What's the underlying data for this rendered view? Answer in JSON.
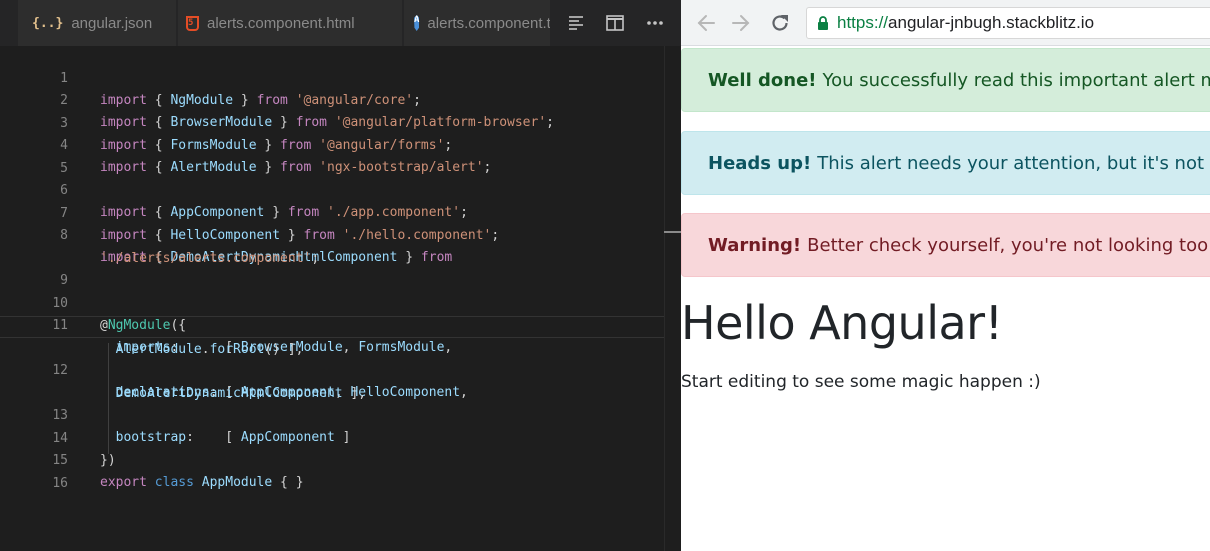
{
  "editor": {
    "tabs": [
      {
        "label": "angular.json",
        "icon": "json-file-icon",
        "icon_glyph": "{..}"
      },
      {
        "label": "alerts.component.html",
        "icon": "html5-file-icon",
        "icon_glyph": "5"
      },
      {
        "label": "alerts.component.ts",
        "icon": "angular-file-icon",
        "icon_glyph": "A"
      }
    ],
    "actions": [
      "outline-icon",
      "split-editor-icon",
      "more-icon"
    ],
    "line_numbers": [
      "1",
      "2",
      "3",
      "4",
      "5",
      "6",
      "7",
      "8",
      "",
      "9",
      "10",
      "11",
      "",
      "12",
      "",
      "13",
      "14",
      "15",
      "16"
    ],
    "code": {
      "l1": [
        "import",
        " { ",
        "NgModule",
        " } ",
        "from",
        " ",
        "'@angular/core'",
        ";"
      ],
      "l2": [
        "import",
        " { ",
        "BrowserModule",
        " } ",
        "from",
        " ",
        "'@angular/platform-browser'",
        ";"
      ],
      "l3": [
        "import",
        " { ",
        "FormsModule",
        " } ",
        "from",
        " ",
        "'@angular/forms'",
        ";"
      ],
      "l4": [
        "import",
        " { ",
        "AlertModule",
        " } ",
        "from",
        " ",
        "'ngx-bootstrap/alert'",
        ";"
      ],
      "l6": [
        "import",
        " { ",
        "AppComponent",
        " } ",
        "from",
        " ",
        "'./app.component'",
        ";"
      ],
      "l7": [
        "import",
        " { ",
        "HelloComponent",
        " } ",
        "from",
        " ",
        "'./hello.component'",
        ";"
      ],
      "l8": [
        "import",
        " { ",
        "DemoAlertDynamicHtmlComponent",
        " } ",
        "from"
      ],
      "l8b": [
        "'./alerts/alerts.component'",
        ";"
      ],
      "l10": [
        "@",
        "NgModule",
        "({"
      ],
      "l11": [
        "  ",
        "imports",
        ":      [ ",
        "BrowserModule",
        ", ",
        "FormsModule",
        ","
      ],
      "l11b": [
        "  ",
        "AlertModule",
        ".",
        "forRoot",
        "() ],"
      ],
      "l12": [
        "  ",
        "declarations",
        ": [ ",
        "AppComponent",
        ", ",
        "HelloComponent",
        ","
      ],
      "l12b": [
        "  ",
        "DemoAlertDynamicHtmlComponent",
        " ],"
      ],
      "l13": [
        "  ",
        "bootstrap",
        ":    [ ",
        "AppComponent",
        " ]"
      ],
      "l14": [
        "})"
      ],
      "l15": [
        "export",
        " ",
        "class",
        " ",
        "AppModule",
        " { }"
      ]
    }
  },
  "browser": {
    "url_scheme": "https://",
    "url_host": "angular-jnbugh.stackblitz.io",
    "alerts": [
      {
        "title": "Well done!",
        "text": "You successfully read this important alert message.",
        "bg": "#d4edda",
        "color": "#155724"
      },
      {
        "title": "Heads up!",
        "text": "This alert needs your attention, but it's not super important.",
        "bg": "#d1ecf1",
        "color": "#0c5460"
      },
      {
        "title": "Warning!",
        "text": "Better check yourself, you're not looking too good.",
        "bg": "#f8d7da",
        "color": "#721c24"
      }
    ],
    "heading": "Hello Angular!",
    "subtext": "Start editing to see some magic happen :)"
  }
}
